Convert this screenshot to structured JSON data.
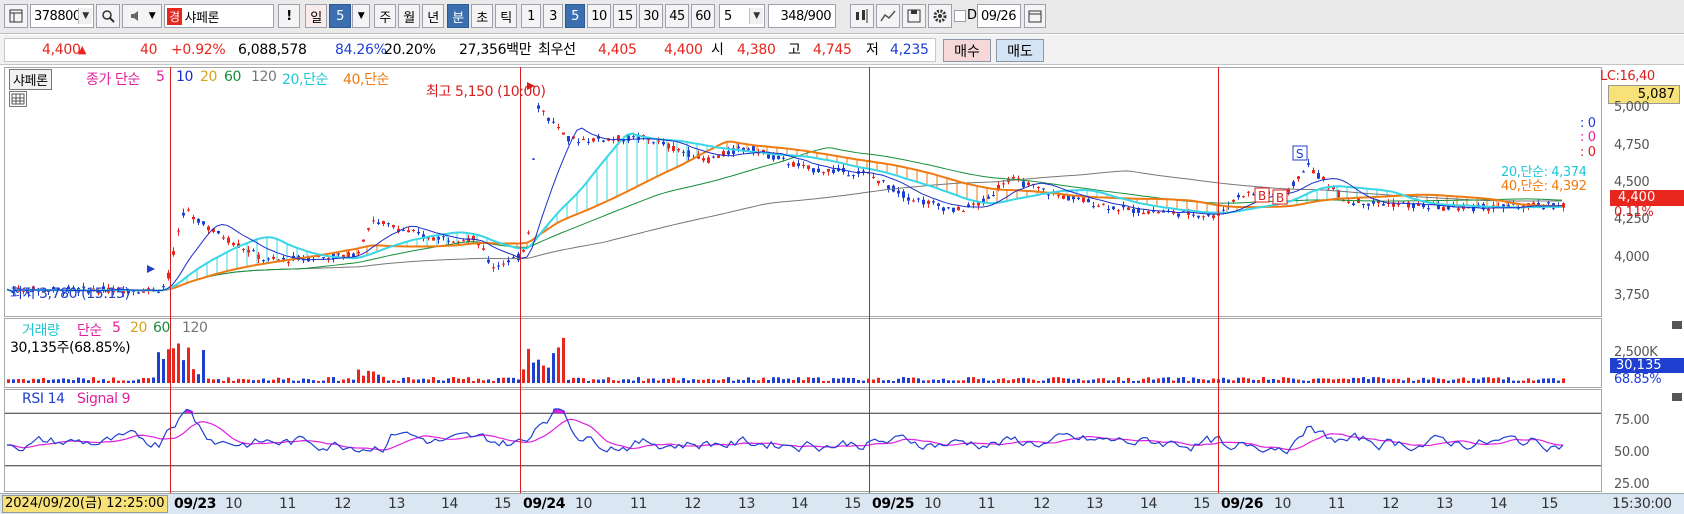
{
  "toolbar": {
    "code": "378800",
    "market_badge": "경",
    "stock_name": "샤페론",
    "periods": [
      "일",
      "5",
      "주",
      "월",
      "년",
      "분",
      "초",
      "틱"
    ],
    "minutes": [
      "1",
      "3",
      "5",
      "10",
      "15",
      "30",
      "45",
      "60"
    ],
    "interval_value": "5",
    "count_current": "348",
    "count_total": "/900",
    "date": "09/26",
    "checkbox_label": "D"
  },
  "quote": {
    "price": "4,400",
    "change": "40",
    "change_pct": "+0.92%",
    "volume": "6,088,578",
    "ratio1": "84.26%",
    "ratio2": "20.20%",
    "amount": "27,356백만",
    "best_label": "최우선",
    "ask": "4,405",
    "bid": "4,400",
    "open_label": "시",
    "open": "4,380",
    "high_label": "고",
    "high": "4,745",
    "low_label": "저",
    "low": "4,235",
    "buy_label": "매수",
    "sell_label": "매도"
  },
  "price_pane": {
    "name_tag": "샤페론",
    "ma_label": "종가 단순",
    "ma_periods": [
      "5",
      "10",
      "20",
      "60",
      "120"
    ],
    "ma_colors": [
      "#e0209f",
      "#1a2ec7",
      "#d9a21a",
      "#168f3a",
      "#777777"
    ],
    "envelope20": "20,단순",
    "envelope40": "40,단순",
    "high_marker": "최고 5,150 (10:00)",
    "low_marker": "최저 3,780 (15:15)",
    "lc_label": "LC:16,40",
    "lc_value": "5,087",
    "right_zeros": [
      ": 0",
      ": 0",
      ": 0"
    ],
    "legend20": "20,단순: 4,374",
    "legend40": "40,단순: 4,392",
    "current_price": "4,400",
    "current_pct": "0.11%",
    "y_ticks": [
      "5,000",
      "4,750",
      "4,500",
      "4,250",
      "4,000",
      "3,750"
    ],
    "signals": [
      "S",
      "B",
      "B"
    ]
  },
  "volume_pane": {
    "label": "거래량",
    "ma_label": "단순",
    "ma_periods": [
      "5",
      "20",
      "60",
      "120"
    ],
    "info": "30,135주(68.85%)",
    "tick": "2,500K",
    "value": "30,135",
    "pct": "68.85%"
  },
  "rsi_pane": {
    "label": "RSI 14",
    "signal_label": "Signal 9",
    "ticks": [
      "75.00",
      "50.00",
      "25.00"
    ]
  },
  "x_axis": {
    "cursor_date": "2024/09/20(금) 12:25:00",
    "labels": [
      {
        "t": "09/23",
        "day": true
      },
      {
        "t": "10"
      },
      {
        "t": "11"
      },
      {
        "t": "12"
      },
      {
        "t": "13"
      },
      {
        "t": "14"
      },
      {
        "t": "15"
      },
      {
        "t": "09/24",
        "day": true
      },
      {
        "t": "10"
      },
      {
        "t": "11"
      },
      {
        "t": "12"
      },
      {
        "t": "13"
      },
      {
        "t": "14"
      },
      {
        "t": "15"
      },
      {
        "t": "09/25",
        "day": true
      },
      {
        "t": "10"
      },
      {
        "t": "11"
      },
      {
        "t": "12"
      },
      {
        "t": "13"
      },
      {
        "t": "14"
      },
      {
        "t": "15"
      },
      {
        "t": "09/26",
        "day": true
      },
      {
        "t": "10"
      },
      {
        "t": "11"
      },
      {
        "t": "12"
      },
      {
        "t": "13"
      },
      {
        "t": "14"
      },
      {
        "t": "15"
      }
    ],
    "end_time": "15:30:00"
  },
  "colors": {
    "up": "#e8261e",
    "down": "#1f3fd1",
    "accent": "#3b6fb0"
  }
}
